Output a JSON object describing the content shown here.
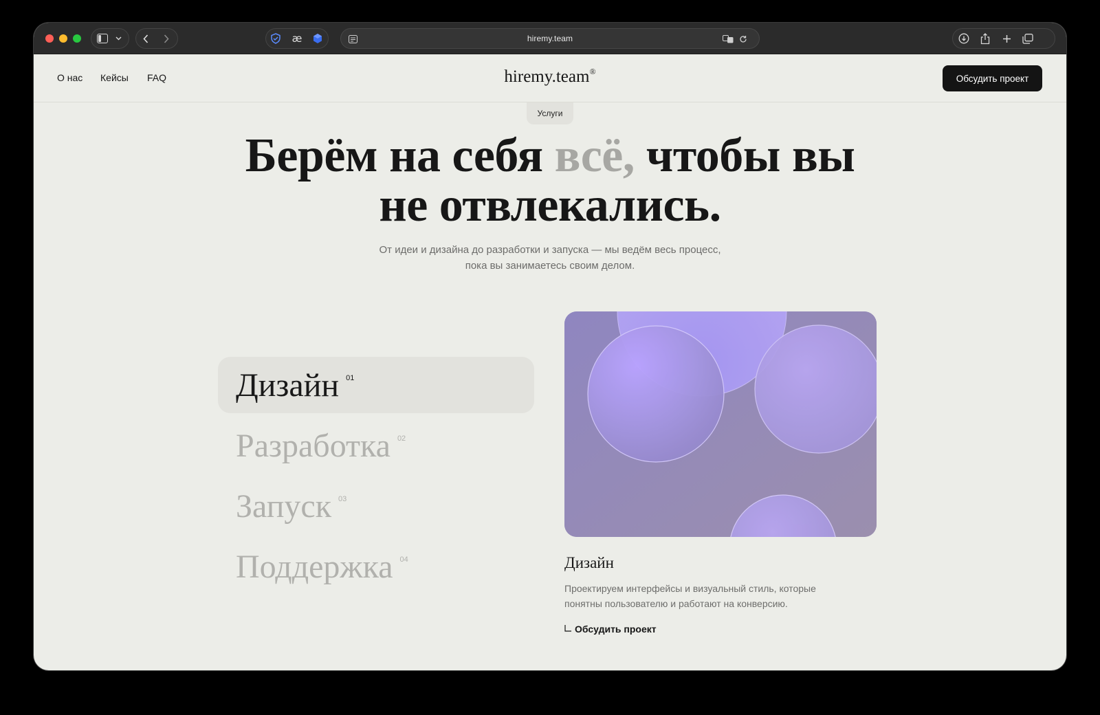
{
  "browser": {
    "url": "hiremy.team"
  },
  "nav": {
    "links": [
      "О нас",
      "Кейсы",
      "FAQ"
    ],
    "logo": "hiremy.team",
    "logo_mark": "®",
    "cta": "Обсудить проект"
  },
  "section_label": "Услуги",
  "hero": {
    "part1": "Берём на себя ",
    "highlight": "всё,",
    "part2": " чтобы вы",
    "line2": "не отвлекались."
  },
  "subtitle": {
    "line1": "От идеи и дизайна до разработки и запуска — мы ведём весь процесс,",
    "line2": "пока вы занимаетесь своим делом."
  },
  "services": [
    {
      "label": "Дизайн",
      "num": "01",
      "active": true
    },
    {
      "label": "Разработка",
      "num": "02",
      "active": false
    },
    {
      "label": "Запуск",
      "num": "03",
      "active": false
    },
    {
      "label": "Поддержка",
      "num": "04",
      "active": false
    }
  ],
  "detail": {
    "title": "Дизайн",
    "text": "Проектируем интерфейсы и визуальный стиль, которые понятны пользователю и работают на конверсию.",
    "link": "Обсудить проект"
  },
  "colors": {
    "background": "#ecede8",
    "cta": "#141414",
    "visual": "#8d84b8"
  }
}
